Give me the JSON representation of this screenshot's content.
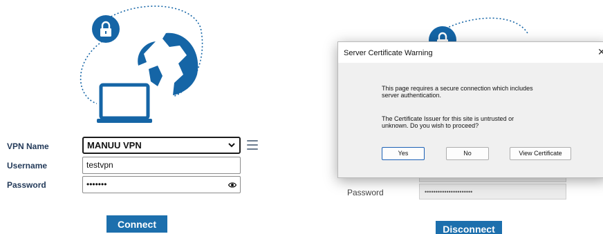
{
  "colors": {
    "brand_blue": "#1c6fad",
    "hero_blue": "#1565a6",
    "dialog_bg": "#f0f0f0"
  },
  "connect_panel": {
    "hero_icon": "vpn-globe-laptop-lock-icon",
    "vpn_name_label": "VPN Name",
    "vpn_name_value": "MANUU VPN",
    "username_label": "Username",
    "username_value": "testvpn",
    "password_label": "Password",
    "password_masked": "•••••••",
    "connect_label": "Connect"
  },
  "disconnect_panel": {
    "password_label": "Password",
    "password_masked": "••••••••••••••••••••••",
    "disconnect_label": "Disconnect"
  },
  "dialog": {
    "title": "Server Certificate Warning",
    "close_glyph": "✕",
    "message_1_line_1": "This page requires a secure connection which includes",
    "message_1_line_2": "server authentication.",
    "message_2_line_1": "The Certificate Issuer for this site is untrusted or",
    "message_2_line_2": "unknown. Do you wish to proceed?",
    "yes_label": "Yes",
    "no_label": "No",
    "view_certificate_label": "View Certificate"
  }
}
